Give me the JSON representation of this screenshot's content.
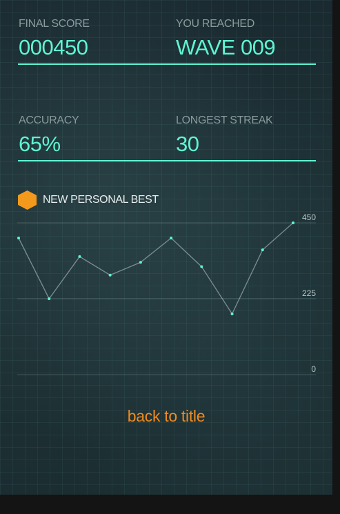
{
  "stats": {
    "final_score": {
      "label": "FINAL SCORE",
      "value": "000450"
    },
    "wave": {
      "label": "YOU REACHED",
      "value": "WAVE 009"
    },
    "accuracy": {
      "label": "ACCURACY",
      "value": "65%"
    },
    "streak": {
      "label": "LONGEST STREAK",
      "value": "30"
    }
  },
  "badge": {
    "label": "NEW PERSONAL BEST",
    "icon": "hexagon-icon",
    "color": "#f39a1c"
  },
  "back_label": "back to title",
  "colors": {
    "accent": "#5ef5d4",
    "highlight": "#f08a1e"
  },
  "chart_data": {
    "type": "line",
    "x": [
      1,
      2,
      3,
      4,
      5,
      6,
      7,
      8,
      9,
      10
    ],
    "values": [
      405,
      225,
      350,
      295,
      333,
      405,
      320,
      180,
      370,
      450
    ],
    "ylim": [
      0,
      450
    ],
    "yticks": [
      "0",
      "225",
      "450"
    ],
    "grid": true
  }
}
